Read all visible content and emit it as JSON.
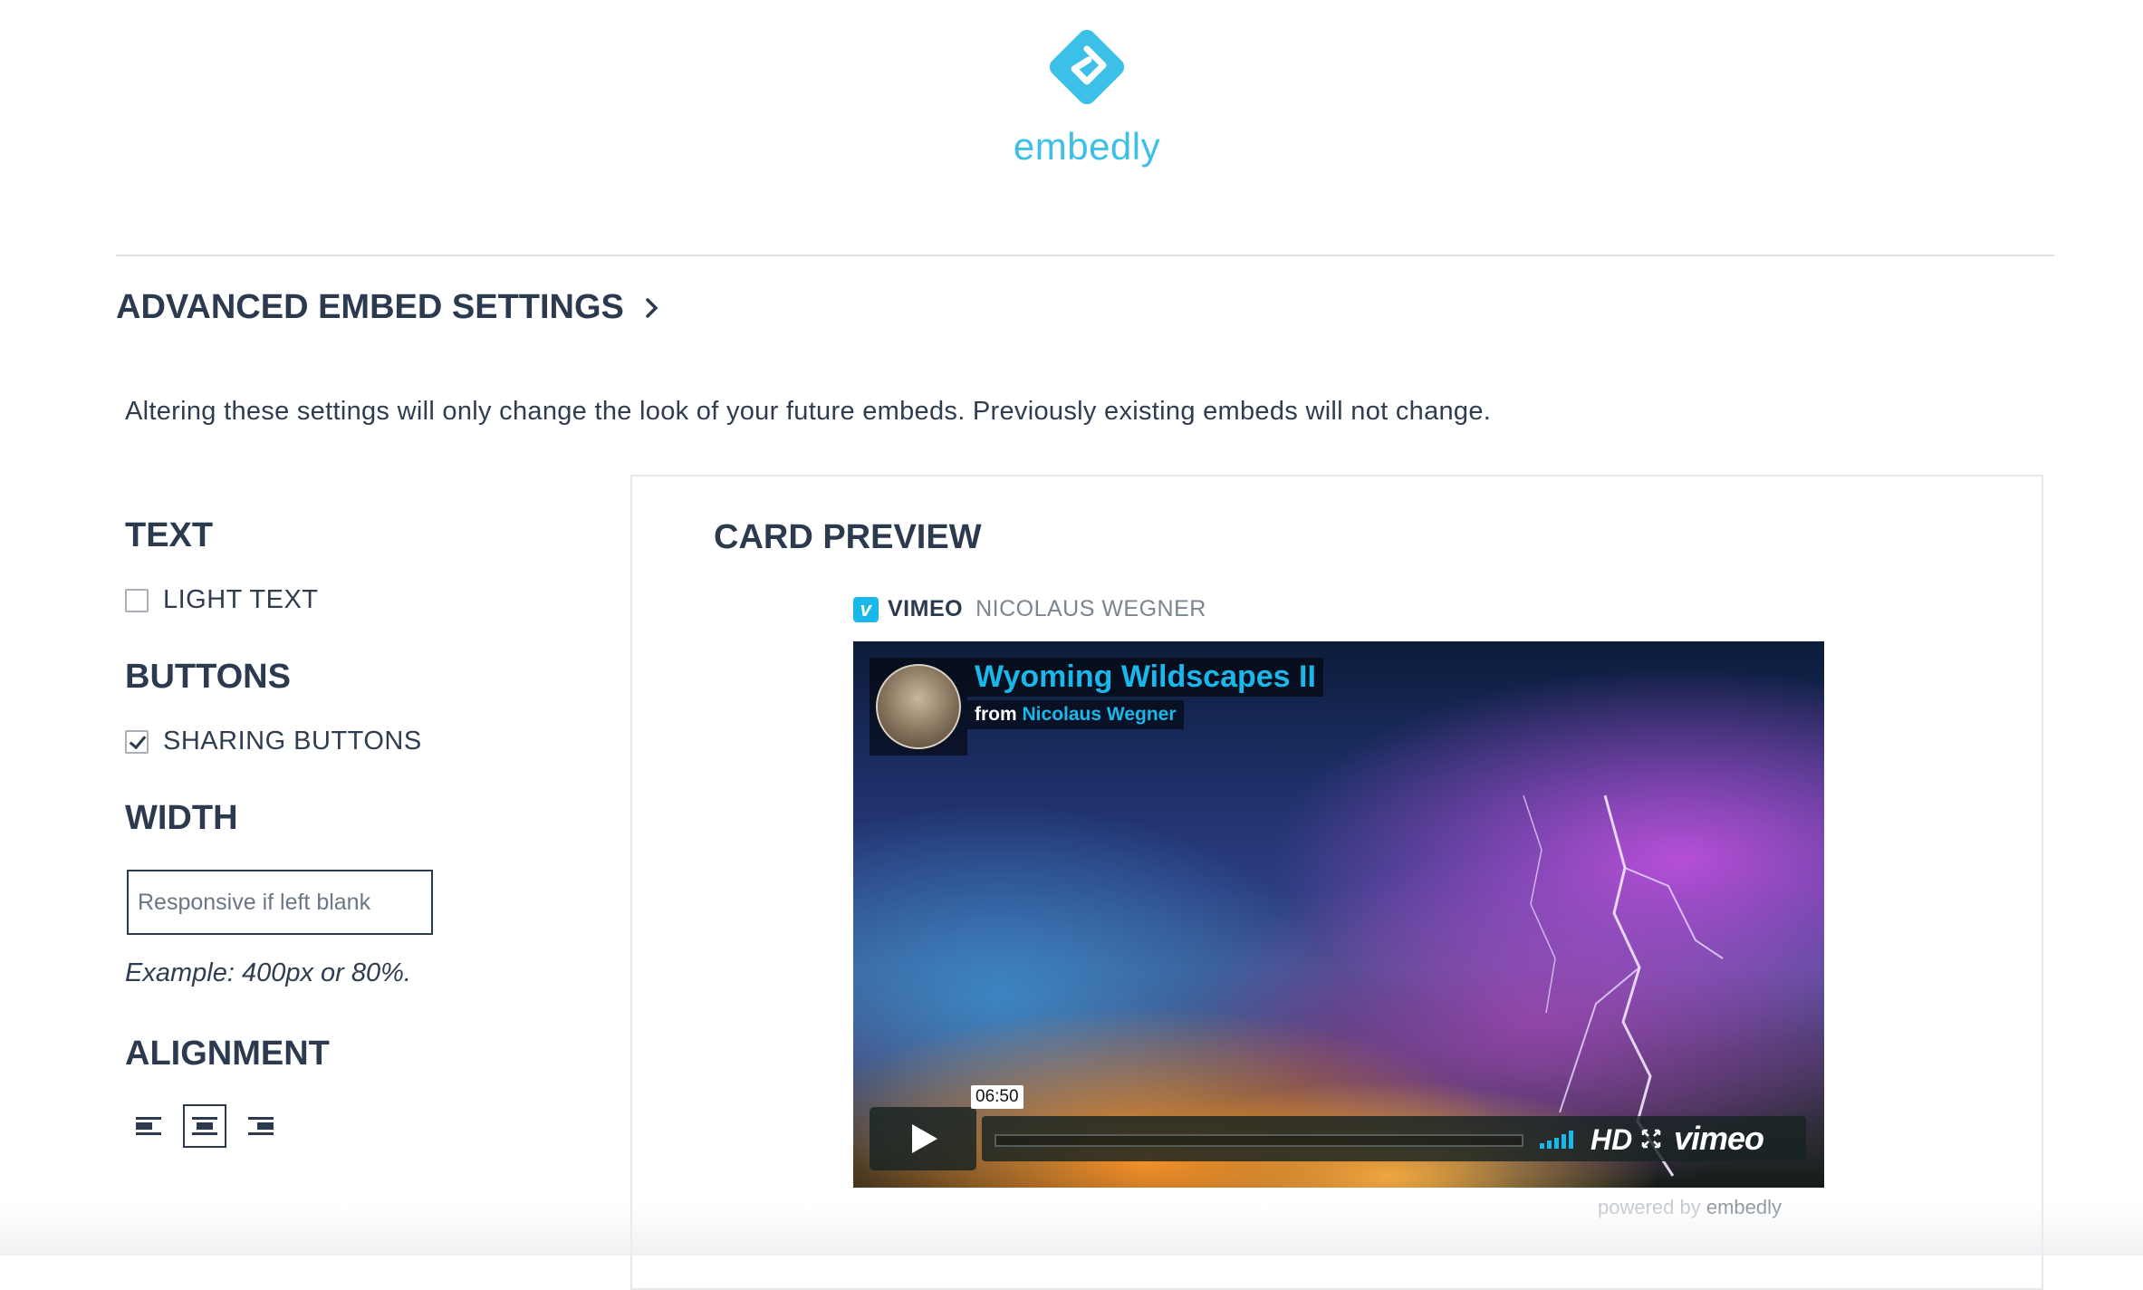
{
  "brand": {
    "name": "embedly",
    "color": "#3dc0e8"
  },
  "header": {
    "advanced_title": "ADVANCED EMBED SETTINGS"
  },
  "notice": "Altering these settings will only change the look of your future embeds. Previously existing embeds will not change.",
  "settings": {
    "text": {
      "title": "TEXT",
      "light_text_label": "LIGHT TEXT",
      "light_text_checked": false
    },
    "buttons": {
      "title": "BUTTONS",
      "sharing_label": "SHARING BUTTONS",
      "sharing_checked": true
    },
    "width": {
      "title": "WIDTH",
      "placeholder": "Responsive if left blank",
      "value": "",
      "example": "Example: 400px or 80%."
    },
    "alignment": {
      "title": "ALIGNMENT",
      "options": [
        "left",
        "center",
        "right"
      ],
      "selected": "center"
    }
  },
  "preview": {
    "title": "CARD PREVIEW",
    "provider": "VIMEO",
    "author": "NICOLAUS WEGNER",
    "video": {
      "title": "Wyoming Wildscapes II",
      "byline_prefix": "from",
      "byline_author": "Nicolaus Wegner",
      "timecode": "06:50",
      "hd_label": "HD",
      "player_brand": "vimeo"
    },
    "powered_prefix": "powered by",
    "powered_brand": "embedly"
  },
  "colors": {
    "accent": "#1ab7ea",
    "heading": "#2b3a4e"
  }
}
